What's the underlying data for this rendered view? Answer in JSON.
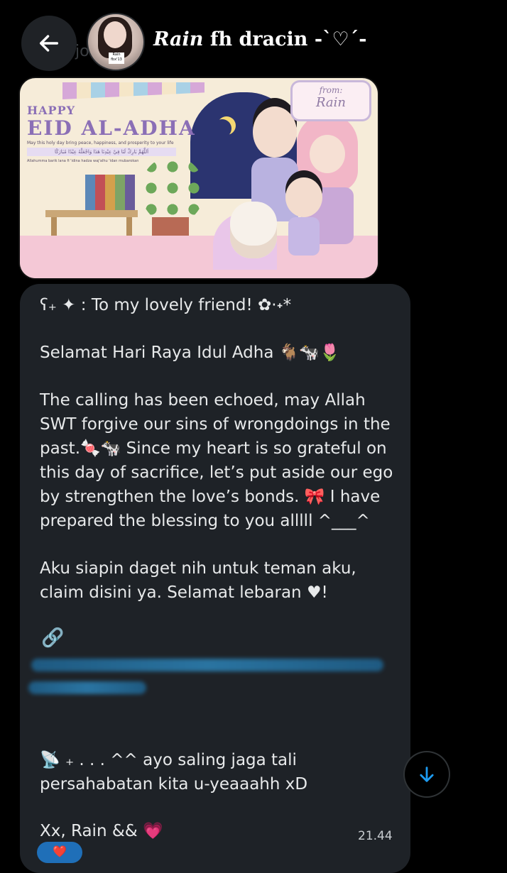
{
  "header": {
    "back_icon": "arrow-left-icon",
    "name_part1": "Rain",
    "name_part2": " fh dracin -`♡´-",
    "ghost": "jo",
    "avatar_tag": "Rain fbx'13"
  },
  "banner": {
    "happy": "HAPPY",
    "eid": "EID AL-ADHA",
    "tagline": "May this holy day bring peace, happiness, and prosperity to your life",
    "arabic": "اَللَّهُمَّ بَارِكْ لَنَا فِيْ عِيْدِنَا هَذَا وَاجْعَلْهُ عِيْدًا مُبَارَكًا",
    "translit": "Allahumma barik lana fi 'idina hadza waj'alhu 'idan mubarokan",
    "from_label": "from:",
    "from_name": "Rain"
  },
  "message": {
    "line1": "ʕ₊ ✦ : To my lovely friend! ✿·˖*",
    "line2": "Selamat Hari Raya Idul Adha 🐐🐄🌷",
    "para1": "The calling has been echoed, may Allah\nSWT forgive our sins of wrongdoings in the\npast.🍬🐄 Since my heart is so grateful on\nthis day of sacrifice, let’s put aside our ego\nby strengthen the love’s bonds. 🎀 I have\nprepared the blessing to you alllll ^___^",
    "para2": "Aku siapin daget nih untuk teman aku,\nclaim disini ya. Selamat lebaran ♥!",
    "link_icon": "link-icon",
    "para3": "📡 ₊ . . . ^^ ayo saling jaga tali\npersahabatan kita u-yeaaahh xD",
    "sign": "Xx, Rain && 💗",
    "time": "21.44"
  },
  "reaction": "❤️",
  "scroll_icon": "arrow-down-icon"
}
